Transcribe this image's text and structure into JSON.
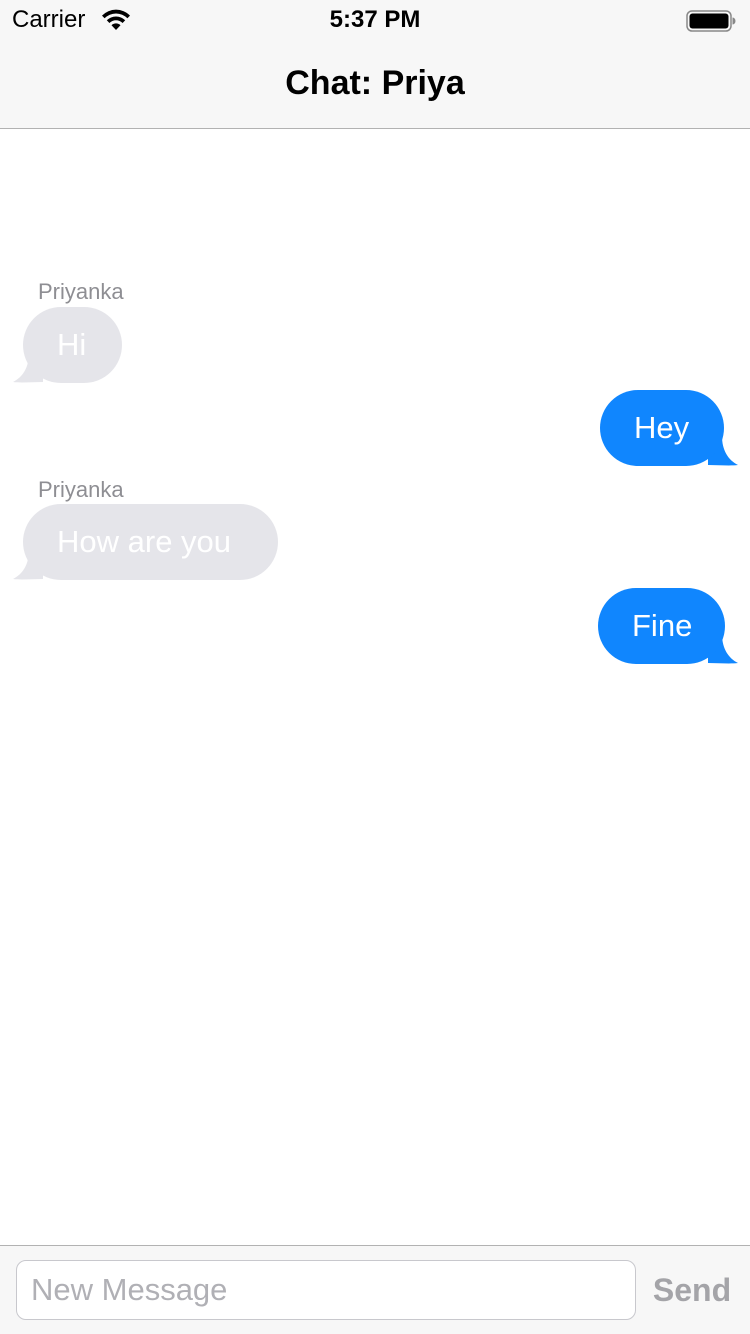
{
  "status_bar": {
    "carrier": "Carrier",
    "time": "5:37 PM",
    "wifi_icon": "wifi-icon",
    "battery_icon": "battery-full-icon"
  },
  "nav": {
    "title": "Chat: Priya"
  },
  "messages": [
    {
      "direction": "incoming",
      "sender": "Priyanka",
      "text": "Hi"
    },
    {
      "direction": "outgoing",
      "sender": "",
      "text": "Hey"
    },
    {
      "direction": "incoming",
      "sender": "Priyanka",
      "text": "How are you"
    },
    {
      "direction": "outgoing",
      "sender": "",
      "text": "Fine"
    }
  ],
  "input_toolbar": {
    "placeholder": "New Message",
    "value": "",
    "send_label": "Send"
  },
  "colors": {
    "outgoing_bubble": "#1086fe",
    "incoming_bubble": "#e5e5ea",
    "bar_background": "#f7f7f7",
    "send_disabled": "#a4a4a8"
  }
}
